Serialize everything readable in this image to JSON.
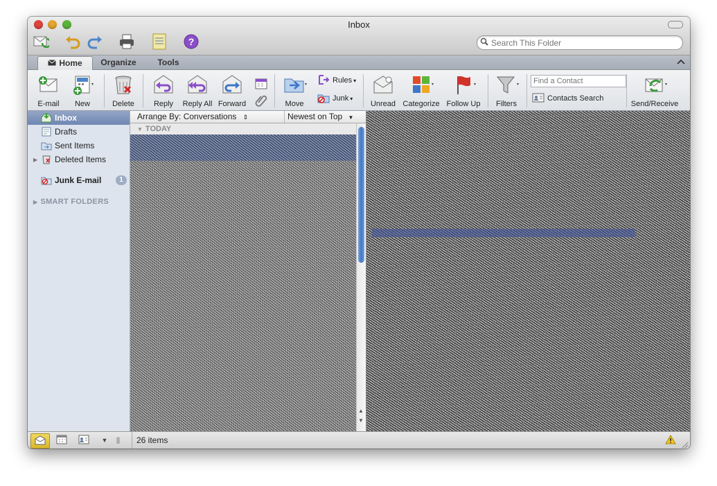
{
  "window": {
    "title": "Inbox"
  },
  "search": {
    "placeholder": "Search This Folder"
  },
  "tabs": [
    {
      "label": "Home"
    },
    {
      "label": "Organize"
    },
    {
      "label": "Tools"
    }
  ],
  "ribbon": {
    "email": "E-mail",
    "new": "New",
    "delete": "Delete",
    "reply": "Reply",
    "reply_all": "Reply All",
    "forward": "Forward",
    "move": "Move",
    "rules": "Rules",
    "junk": "Junk",
    "unread": "Unread",
    "categorize": "Categorize",
    "follow_up": "Follow Up",
    "filters": "Filters",
    "find_contact_placeholder": "Find a Contact",
    "contacts_search": "Contacts Search",
    "send_receive": "Send/Receive"
  },
  "sidebar": {
    "folders": [
      {
        "label": "Inbox",
        "selected": true
      },
      {
        "label": "Drafts"
      },
      {
        "label": "Sent Items"
      },
      {
        "label": "Deleted Items"
      },
      {
        "label": "Junk E-mail",
        "count": "1"
      }
    ],
    "smart_folders": "SMART FOLDERS"
  },
  "message_list": {
    "arrange_by": "Arrange By: Conversations",
    "sort": "Newest on Top",
    "group": "TODAY"
  },
  "status": {
    "items": "26 items"
  },
  "colors": {
    "selection": "#7289b6",
    "sidebar_bg": "#dde4ee",
    "scroll_thumb": "#3f77c7",
    "badge": "#9eadc3"
  },
  "icons": [
    "mail-icon",
    "undo-icon",
    "redo-icon",
    "print-icon",
    "notes-icon",
    "help-icon",
    "search-icon",
    "warning-icon"
  ]
}
